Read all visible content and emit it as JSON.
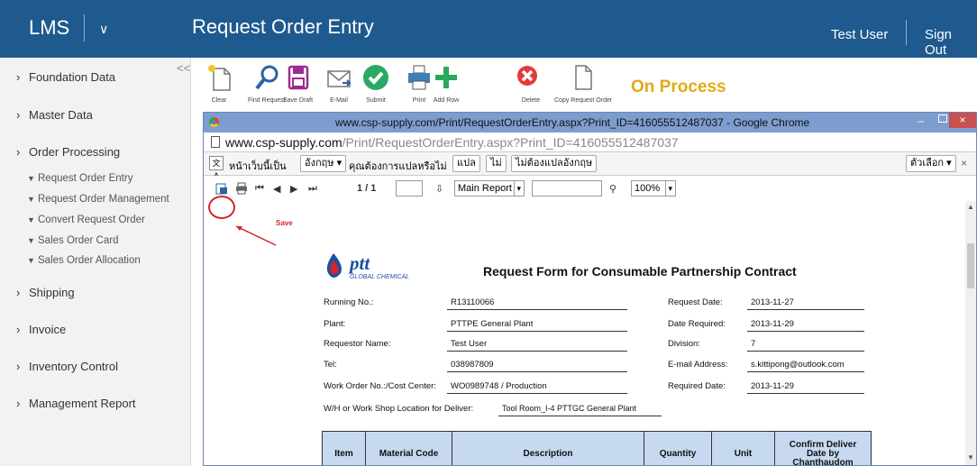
{
  "app": {
    "logo": "LMS",
    "title": "Request Order Entry",
    "user": "Test User",
    "signout": "Sign Out"
  },
  "sidebar": {
    "collapse": "<<",
    "sections": [
      "Foundation Data",
      "Master Data",
      "Order Processing",
      "Shipping",
      "Invoice",
      "Inventory Control",
      "Management Report"
    ],
    "subitems": [
      "Request Order Entry",
      "Request Order Management",
      "Convert Request Order",
      "Sales Order Card",
      "Sales Order Allocation"
    ]
  },
  "toolbar": {
    "buttons": [
      "Clear",
      "Find Request",
      "Save Draft",
      "E-Mail",
      "Submit",
      "Print",
      "Add Row",
      "Delete",
      "Copy Request Order"
    ],
    "status": "On Process"
  },
  "chrome": {
    "title": "www.csp-supply.com/Print/RequestOrderEntry.aspx?Print_ID=416055512487037 - Google Chrome",
    "url_host": "www.csp-supply.com",
    "url_path": "/Print/RequestOrderEntry.aspx?Print_ID=416055512487037",
    "translate": {
      "prompt": "หน้าเว็บนี้เป็น",
      "lang": "อังกฤษ ▾",
      "ask": "คุณต้องการแปลหรือไม่",
      "translate": "แปล",
      "no": "ไม่",
      "never": "ไม่ต้องแปลอังกฤษ",
      "options": "ตัวเลือก ▾",
      "close": "×"
    }
  },
  "viewer": {
    "page": "1 / 1",
    "report": "Main Report",
    "zoom": "100%",
    "save_annotation": "Save"
  },
  "report": {
    "logo": "pttGLOBAL CHEMICAL",
    "title": "Request Form for Consumable Partnership Contract",
    "fields": {
      "running_no_label": "Running No.:",
      "running_no": "R13110066",
      "plant_label": "Plant:",
      "plant": "PTTPE General Plant",
      "requestor_label": "Requestor Name:",
      "requestor": "Test User",
      "tel_label": "Tel:",
      "tel": "038987809",
      "work_order_label": "Work Order No.:/Cost Center:",
      "work_order": "WO0989748 / Production",
      "location_label": "W/H or Work Shop Location for Deliver:",
      "location": "Tool Room_I-4 PTTGC General Plant",
      "request_date_label": "Request Date:",
      "request_date": "2013-11-27",
      "date_required_label": "Date Required:",
      "date_required": "2013-11-29",
      "division_label": "Division:",
      "division": "7",
      "email_label": "E-mail Address:",
      "email": "s.kittipong@outlook.com",
      "required_date_label": "Required Date:",
      "required_date": "2013-11-29"
    },
    "columns": [
      "Item",
      "Material Code",
      "Description",
      "Quantity",
      "Unit",
      "Confirm Deliver Date by Chanthaudom"
    ]
  }
}
